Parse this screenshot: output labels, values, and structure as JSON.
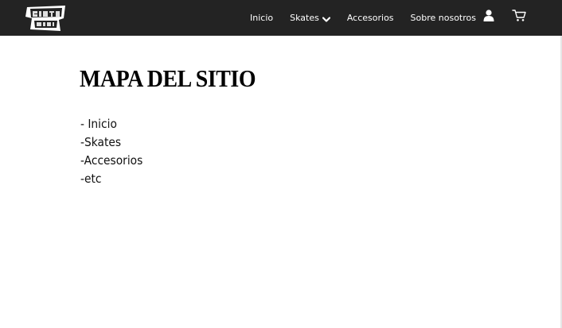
{
  "header": {
    "logo_text": "SKATE OR DIE!",
    "nav": [
      {
        "label": "Inicio"
      },
      {
        "label": "Skates",
        "has_dropdown": true
      },
      {
        "label": "Accesorios"
      },
      {
        "label": "Sobre nosotros"
      }
    ],
    "icons": [
      "user-icon",
      "cart-icon"
    ],
    "background_color": "#232323"
  },
  "main": {
    "title": "MAPA DEL SITIO",
    "sitemap_items": [
      "- Inicio",
      "-Skates",
      "-Accesorios",
      "-etc"
    ]
  }
}
